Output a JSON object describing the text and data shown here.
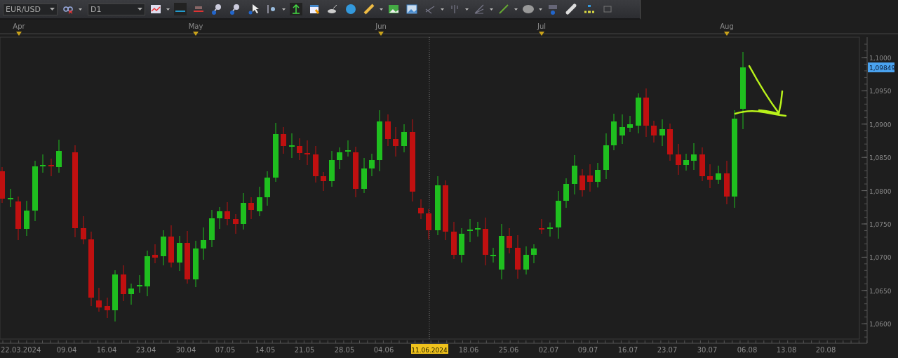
{
  "toolbar": {
    "symbol": "EUR/USD",
    "timeframe": "D1"
  },
  "chart": {
    "months": [
      "Apr",
      "May",
      "Jun",
      "Jul",
      "Aug"
    ],
    "price_labels": [
      "1,1000",
      "1,0950",
      "1,0900",
      "1,0850",
      "1,0800",
      "1,0750",
      "1,0700",
      "1,0650",
      "1,0600"
    ],
    "current_price": "1,09849",
    "date_labels": [
      "22.03.2024",
      "09.04",
      "16.04",
      "23.04",
      "30.04",
      "07.05",
      "14.05",
      "21.05",
      "28.05",
      "04.06",
      "18.06",
      "25.06",
      "02.07",
      "09.07",
      "16.07",
      "23.07",
      "30.07",
      "06.08",
      "13.08",
      "20.08"
    ],
    "crosshair_date": "11.06.2024"
  }
}
